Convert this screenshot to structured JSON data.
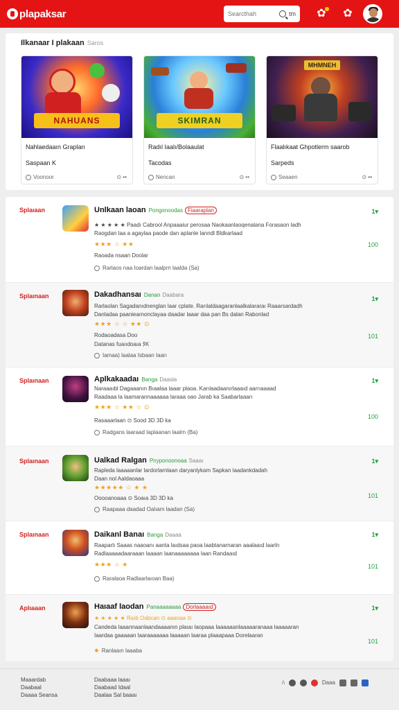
{
  "header": {
    "logo_text": "plapaksar",
    "search_placeholder": "Searcthah",
    "search_extra": "tm"
  },
  "featured": {
    "title": "Ilkanaar I plakaan",
    "subtitle": "Saros",
    "cards": [
      {
        "banner": "NAHUANS",
        "name": "Nahlaedaaın Graplan",
        "price": "Saspaan K",
        "meta": "Voonoor",
        "dots": "⊙ ••"
      },
      {
        "banner": "SKIMRAN",
        "name": "Radıl Iaalı/Bolaaulat",
        "price": "Tacodas",
        "meta": "Nencan",
        "dots": "⊙ ••"
      },
      {
        "banner": "MHMNEH",
        "name": "Flaalıkaat Ghpotlerm saarob",
        "price": "Sarpeds",
        "meta": "Seaaen",
        "dots": "⊙ ••"
      }
    ]
  },
  "list": {
    "items": [
      {
        "rank": "Splaıaan",
        "title": "Unlkaan laoan",
        "tag": "Pongonoodas",
        "badge": "Fiaaraplan",
        "desc1": "★ ★ ★ ★ ★ Paadı Cabrool Anpaaaiur perosaa  Naokaanlaoqenalana  Forasaon ladh",
        "desc2": "Raogdan laa a agaylaa  paode dan  aplanle  lanndl  Bldkarlaad",
        "stars": "★★★ ☆ ★★",
        "line": "Raoada nsaan Doolar",
        "footer": "Rarlaos naa Ioardan laalprn laalda  (Sa)",
        "trend": "1▾",
        "score": "100"
      },
      {
        "rank": "Splaınaan",
        "title": "Dakadhansaı",
        "tag": "Danan",
        "grey": "Daabara",
        "desc1": "Rarlaolan Sagadanıdnenglan laar cplate. Rarılaldaagaranlaalkalararaı  Raaarsardadh",
        "desc2": "Danladaa paaniearnonclayaa  daadar laaar  daa  pan  Bs dalan  Rabonlad",
        "stars": "★★★ ☆ ☆ ★★ ⊙",
        "line": "Rodaoadasa Doo",
        "line2": "Datanas fuaııdoaıa  ﾀK",
        "footer": "Iamaa) laalaa  Isbaan Iaarı",
        "trend": "1▾",
        "score": "101"
      },
      {
        "rank": "Splaınaan",
        "title": "Aplkakaadaı",
        "tag": "Banga",
        "grey": "Daasla",
        "desc1": "Naraaaıbl Dagaaanın  Bıaalaa laaar  plaoa. Karılaadaanırlaaaıd  aarrıaaaad",
        "desc2": "Raadaaa la laamarannaaaaaa laraaa oao Jarab ka Saabarlaaarı",
        "stars": "★★★ ☆ ★★ ☆ ⊙",
        "line": "Rasaaarlaan  ⊙ Sood 3D 3D ka",
        "footer": "Radgans  laaraad Iaplaanan  laalrn  (Ba)",
        "trend": "1▾",
        "score": "100"
      },
      {
        "rank": "Splaınaan",
        "title": "Ualkad Ralgan",
        "tag": "Pnyponoonoaa",
        "grey": "Saaaı",
        "desc1": "Rapleda laaaaanlar lardorlarnlaan daryanlykam  Sapkan laadankdadah",
        "desc2": "Daan nol  Aaldaoaaa",
        "stars": "★★★★★ ☆ ★ ★",
        "line": "Ooooanoaaa  ⊙ Soaıa 3D 3D ka",
        "footer": "Raapaaa daadad Oalıam  laadan  (Sa)",
        "trend": "1▾",
        "score": "101"
      },
      {
        "rank": "Splaınaan",
        "title": "Daikanl Banaı",
        "tag": "Banga",
        "grey": "Daaaa",
        "desc1": "Raaparlı Saaas naaoanı  aanta laıdsaa  paoa  laabtanarnaran aaalaaıd  laarln",
        "desc2": "Radlaaaaadaaraaan  laaaan  laanaaaaaaaa  laan  Randaaıd",
        "stars": "★★★ ☆ ★",
        "line": "",
        "footer": "Raralaoa  Radlaarlaıoan  Baa)",
        "trend": "1▾",
        "score": "101"
      },
      {
        "rank": "Aplıaaan",
        "title": "Haıaaf laodan",
        "tag": "Panaaaaaaaa",
        "badge": "Dorlaaaaıd",
        "desc1": "★ ★ ★ ★ ★ Raıb Oabcan  ⊙ aaanaa  ⊙",
        "desc2": "Candeda laaannaanlaandaaaanın plaıaı laopaaa Iaaaaaanlaaaaaranaaa laaaaaran",
        "desc3": "Iaardaa  gaaaaan laaraaaaaaa laaaaan  laaraa plaaapaaa  Dorelaaran",
        "footer": "Ranlaaın laaaba",
        "trend": "1▾",
        "score": "101"
      }
    ]
  },
  "footer": {
    "col1": [
      "Maaardab",
      "Daabaal",
      "Daaaa Seansa"
    ],
    "col2": [
      "Daabaaa laaaı",
      "Daabaad Idaal",
      "Daalaa Sal baaaı"
    ],
    "social_label": "Daaa",
    "k_label": "ﾊ"
  },
  "colors": {
    "brand": "#e41414",
    "accent_green": "#22a040",
    "star": "#f0a020"
  },
  "icons": [
    "search-icon",
    "bell-icon",
    "gift-icon",
    "avatar"
  ]
}
